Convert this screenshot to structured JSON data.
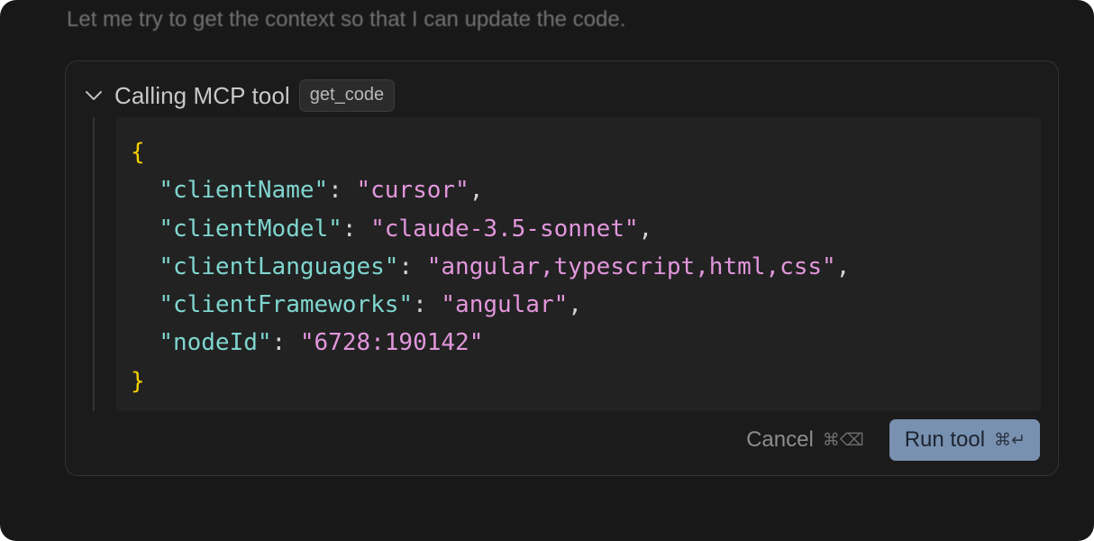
{
  "window": {
    "cut_text": "Let me try to get the context so that I can update the code."
  },
  "tool_call": {
    "title": "Calling MCP tool",
    "tool_name": "get_code",
    "expanded_icon": "chevron-down-icon",
    "code": {
      "open_brace": "{",
      "close_brace": "}",
      "params": [
        {
          "key": "\"clientName\"",
          "value": "\"cursor\"",
          "trailing": ","
        },
        {
          "key": "\"clientModel\"",
          "value": "\"claude-3.5-sonnet\"",
          "trailing": ","
        },
        {
          "key": "\"clientLanguages\"",
          "value": "\"angular,typescript,html,css\"",
          "trailing": ","
        },
        {
          "key": "\"clientFrameworks\"",
          "value": "\"angular\"",
          "trailing": ","
        },
        {
          "key": "\"nodeId\"",
          "value": "\"6728:190142\"",
          "trailing": ""
        }
      ]
    },
    "cancel_label": "Cancel",
    "cancel_shortcut": "⌘⌫",
    "run_label": "Run tool",
    "run_shortcut": "⌘↵"
  },
  "colors": {
    "background": "#181818",
    "key": "#7fd6cf",
    "string": "#e296dc",
    "brace": "#f5d000",
    "run_button": "#7991b1"
  }
}
